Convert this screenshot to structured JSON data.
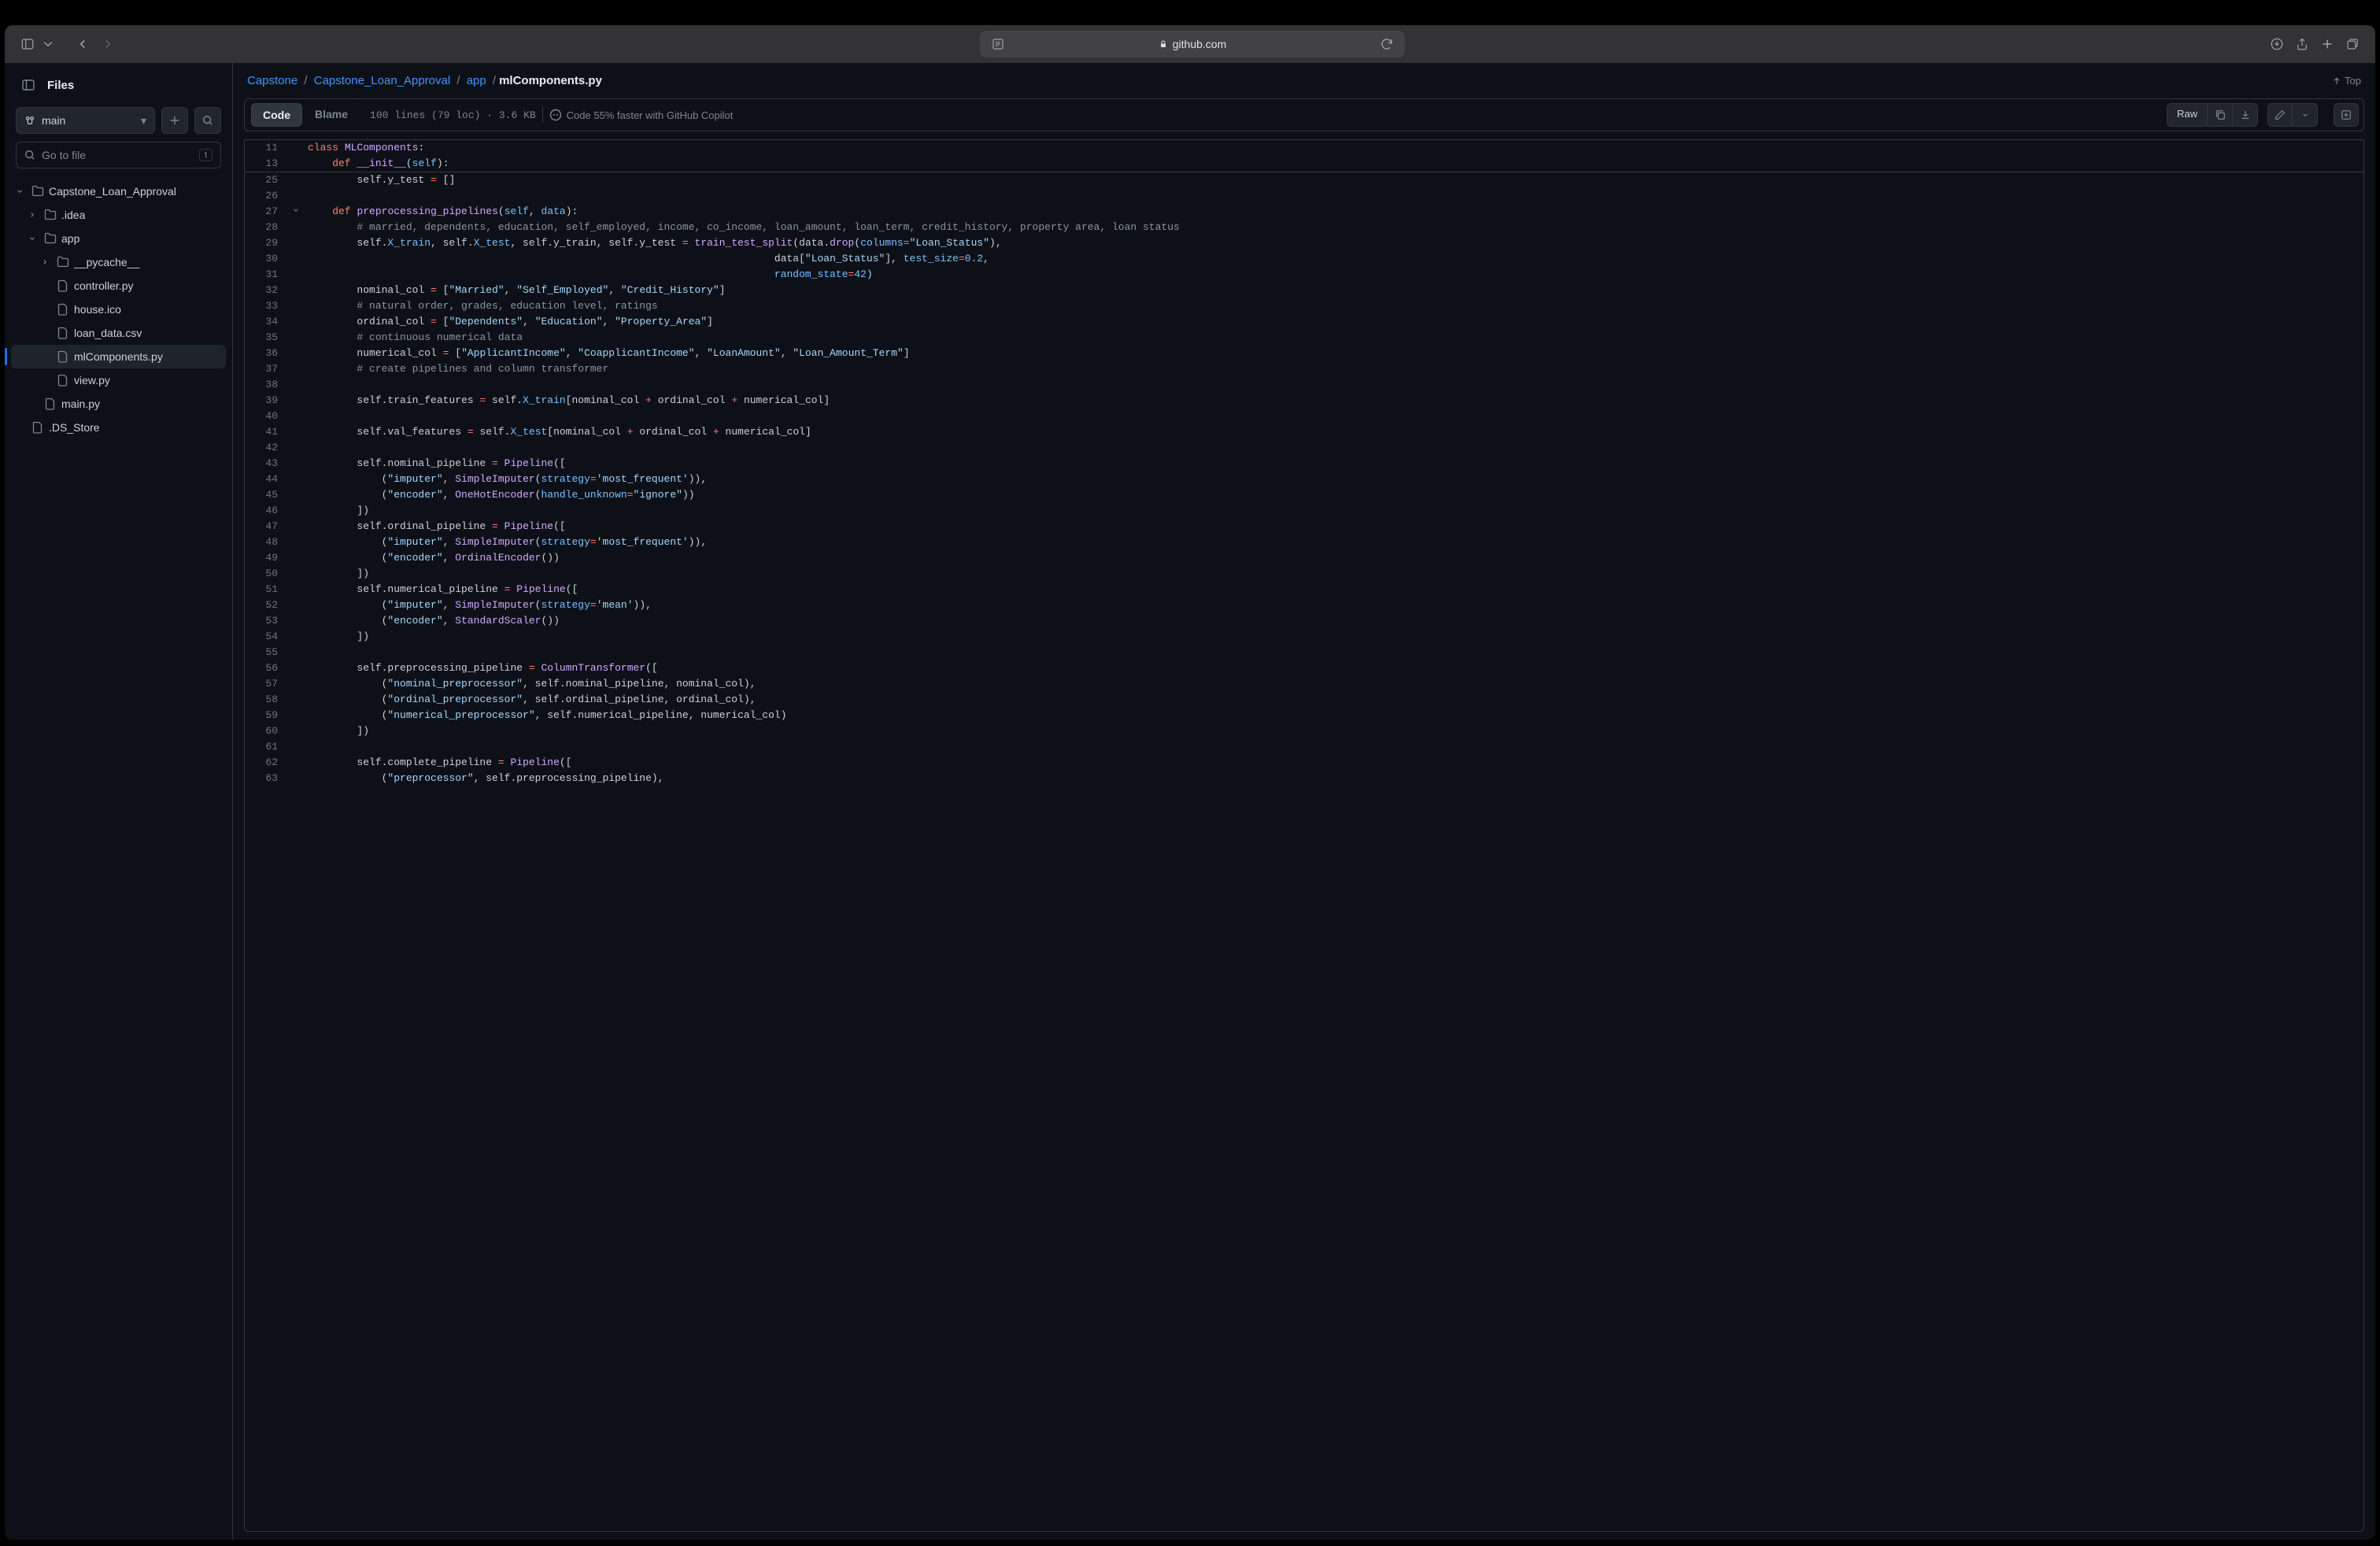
{
  "browser": {
    "url_host": "github.com"
  },
  "sidebar": {
    "title": "Files",
    "branch": "main",
    "search_placeholder": "Go to file",
    "search_kbd": "t",
    "tree": [
      {
        "kind": "folder",
        "name": "Capstone_Loan_Approval",
        "depth": 0,
        "expanded": true
      },
      {
        "kind": "folder",
        "name": ".idea",
        "depth": 1,
        "expanded": false
      },
      {
        "kind": "folder",
        "name": "app",
        "depth": 1,
        "expanded": true
      },
      {
        "kind": "folder",
        "name": "__pycache__",
        "depth": 2,
        "expanded": false
      },
      {
        "kind": "file",
        "name": "controller.py",
        "depth": 2
      },
      {
        "kind": "file",
        "name": "house.ico",
        "depth": 2
      },
      {
        "kind": "file",
        "name": "loan_data.csv",
        "depth": 2
      },
      {
        "kind": "file",
        "name": "mlComponents.py",
        "depth": 2,
        "active": true
      },
      {
        "kind": "file",
        "name": "view.py",
        "depth": 2
      },
      {
        "kind": "file",
        "name": "main.py",
        "depth": 1
      },
      {
        "kind": "file",
        "name": ".DS_Store",
        "depth": 0
      }
    ]
  },
  "breadcrumbs": {
    "parts": [
      "Capstone",
      "Capstone_Loan_Approval",
      "app"
    ],
    "current": "mlComponents.py",
    "top_label": "Top"
  },
  "toolbar": {
    "tab_code": "Code",
    "tab_blame": "Blame",
    "file_info": "100 lines (79 loc) · 3.6 KB",
    "copilot_hint": "Code 55% faster with GitHub Copilot",
    "raw_label": "Raw"
  },
  "sticky": [
    {
      "num": 11,
      "html": "<span class='tk-k'>class</span> <span class='tk-f'>MLComponents</span>:"
    },
    {
      "num": 13,
      "html": "    <span class='tk-k'>def</span> <span class='tk-f'>__init__</span>(<span class='tk-n'>self</span>):"
    }
  ],
  "code": [
    {
      "num": 25,
      "html": "        self.y_test <span class='tk-k'>=</span> []"
    },
    {
      "num": 26,
      "html": ""
    },
    {
      "num": 27,
      "gutter": "chev",
      "html": "    <span class='tk-k'>def</span> <span class='tk-f'>preprocessing_pipelines</span>(<span class='tk-n'>self</span>, <span class='tk-n'>data</span>):"
    },
    {
      "num": 28,
      "html": "        <span class='tk-c'># married, dependents, education, self_employed, income, co_income, loan_amount, loan_term, credit_history, property area, loan status</span>"
    },
    {
      "num": 29,
      "html": "        self.<span class='tk-n'>X_train</span>, self.<span class='tk-n'>X_test</span>, self.y_train, self.y_test <span class='tk-k'>=</span> <span class='tk-f'>train_test_split</span>(data.<span class='tk-f'>drop</span>(<span class='tk-n'>columns</span><span class='tk-k'>=</span><span class='tk-s'>\"Loan_Status\"</span>),"
    },
    {
      "num": 30,
      "html": "                                                                            data[<span class='tk-s'>\"Loan_Status\"</span>], <span class='tk-n'>test_size</span><span class='tk-k'>=</span><span class='tk-n'>0.2</span>,"
    },
    {
      "num": 31,
      "html": "                                                                            <span class='tk-n'>random_state</span><span class='tk-k'>=</span><span class='tk-n'>42</span>)"
    },
    {
      "num": 32,
      "html": "        nominal_col <span class='tk-k'>=</span> [<span class='tk-s'>\"Married\"</span>, <span class='tk-s'>\"Self_Employed\"</span>, <span class='tk-s'>\"Credit_History\"</span>]"
    },
    {
      "num": 33,
      "html": "        <span class='tk-c'># natural order, grades, education level, ratings</span>"
    },
    {
      "num": 34,
      "html": "        ordinal_col <span class='tk-k'>=</span> [<span class='tk-s'>\"Dependents\"</span>, <span class='tk-s'>\"Education\"</span>, <span class='tk-s'>\"Property_Area\"</span>]"
    },
    {
      "num": 35,
      "html": "        <span class='tk-c'># continuous numerical data</span>"
    },
    {
      "num": 36,
      "html": "        numerical_col <span class='tk-k'>=</span> [<span class='tk-s'>\"ApplicantIncome\"</span>, <span class='tk-s'>\"CoapplicantIncome\"</span>, <span class='tk-s'>\"LoanAmount\"</span>, <span class='tk-s'>\"Loan_Amount_Term\"</span>]"
    },
    {
      "num": 37,
      "html": "        <span class='tk-c'># create pipelines and column transformer</span>"
    },
    {
      "num": 38,
      "html": ""
    },
    {
      "num": 39,
      "html": "        self.train_features <span class='tk-k'>=</span> self.<span class='tk-n'>X_train</span>[nominal_col <span class='tk-k'>+</span> ordinal_col <span class='tk-k'>+</span> numerical_col]"
    },
    {
      "num": 40,
      "html": ""
    },
    {
      "num": 41,
      "html": "        self.val_features <span class='tk-k'>=</span> self.<span class='tk-n'>X_test</span>[nominal_col <span class='tk-k'>+</span> ordinal_col <span class='tk-k'>+</span> numerical_col]"
    },
    {
      "num": 42,
      "html": ""
    },
    {
      "num": 43,
      "html": "        self.nominal_pipeline <span class='tk-k'>=</span> <span class='tk-f'>Pipeline</span>(["
    },
    {
      "num": 44,
      "html": "            (<span class='tk-s'>\"imputer\"</span>, <span class='tk-f'>SimpleImputer</span>(<span class='tk-n'>strategy</span><span class='tk-k'>=</span><span class='tk-s'>'most_frequent'</span>)),"
    },
    {
      "num": 45,
      "html": "            (<span class='tk-s'>\"encoder\"</span>, <span class='tk-f'>OneHotEncoder</span>(<span class='tk-n'>handle_unknown</span><span class='tk-k'>=</span><span class='tk-s'>\"ignore\"</span>))"
    },
    {
      "num": 46,
      "html": "        ])"
    },
    {
      "num": 47,
      "html": "        self.ordinal_pipeline <span class='tk-k'>=</span> <span class='tk-f'>Pipeline</span>(["
    },
    {
      "num": 48,
      "html": "            (<span class='tk-s'>\"imputer\"</span>, <span class='tk-f'>SimpleImputer</span>(<span class='tk-n'>strategy</span><span class='tk-k'>=</span><span class='tk-s'>'most_frequent'</span>)),"
    },
    {
      "num": 49,
      "html": "            (<span class='tk-s'>\"encoder\"</span>, <span class='tk-f'>OrdinalEncoder</span>())"
    },
    {
      "num": 50,
      "html": "        ])"
    },
    {
      "num": 51,
      "html": "        self.numerical_pipeline <span class='tk-k'>=</span> <span class='tk-f'>Pipeline</span>(["
    },
    {
      "num": 52,
      "html": "            (<span class='tk-s'>\"imputer\"</span>, <span class='tk-f'>SimpleImputer</span>(<span class='tk-n'>strategy</span><span class='tk-k'>=</span><span class='tk-s'>'mean'</span>)),"
    },
    {
      "num": 53,
      "html": "            (<span class='tk-s'>\"encoder\"</span>, <span class='tk-f'>StandardScaler</span>())"
    },
    {
      "num": 54,
      "html": "        ])"
    },
    {
      "num": 55,
      "html": ""
    },
    {
      "num": 56,
      "html": "        self.preprocessing_pipeline <span class='tk-k'>=</span> <span class='tk-f'>ColumnTransformer</span>(["
    },
    {
      "num": 57,
      "html": "            (<span class='tk-s'>\"nominal_preprocessor\"</span>, self.nominal_pipeline, nominal_col),"
    },
    {
      "num": 58,
      "html": "            (<span class='tk-s'>\"ordinal_preprocessor\"</span>, self.ordinal_pipeline, ordinal_col),"
    },
    {
      "num": 59,
      "html": "            (<span class='tk-s'>\"numerical_preprocessor\"</span>, self.numerical_pipeline, numerical_col)"
    },
    {
      "num": 60,
      "html": "        ])"
    },
    {
      "num": 61,
      "html": ""
    },
    {
      "num": 62,
      "html": "        self.complete_pipeline <span class='tk-k'>=</span> <span class='tk-f'>Pipeline</span>(["
    },
    {
      "num": 63,
      "html": "            (<span class='tk-s'>\"preprocessor\"</span>, self.preprocessing_pipeline),"
    }
  ]
}
